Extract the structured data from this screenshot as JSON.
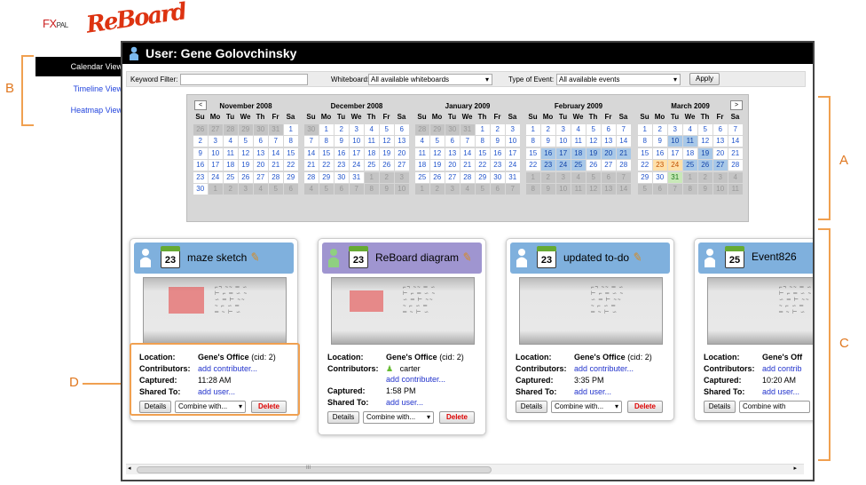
{
  "logos": {
    "fxpal": "FX",
    "fxpal_tail": "PAL",
    "reboard": "ReBoard"
  },
  "callouts": {
    "a": "A",
    "b": "B",
    "c": "C",
    "d": "D"
  },
  "sidebar": {
    "items": [
      {
        "label": "Calendar View",
        "active": true
      },
      {
        "label": "Timeline View",
        "active": false
      },
      {
        "label": "Heatmap View",
        "active": false
      }
    ]
  },
  "window": {
    "title": "User: Gene Golovchinsky"
  },
  "filters": {
    "keyword_label": "Keyword Filter:",
    "keyword_value": "",
    "whiteboard_label": "Whiteboard:",
    "whiteboard_value": "All available whiteboards",
    "event_type_label": "Type of Event:",
    "event_type_value": "All available events",
    "apply_label": "Apply"
  },
  "calendar": {
    "prev": "<",
    "next": ">",
    "weekdays": [
      "Su",
      "Mo",
      "Tu",
      "We",
      "Th",
      "Fr",
      "Sa"
    ],
    "months": [
      {
        "title": "November 2008",
        "days": [
          [
            "26",
            "o"
          ],
          [
            "27",
            "o"
          ],
          [
            "28",
            "o"
          ],
          [
            "29",
            "o"
          ],
          [
            "30",
            "o"
          ],
          [
            "31",
            "o"
          ],
          [
            "1",
            ""
          ],
          [
            "2",
            ""
          ],
          [
            "3",
            ""
          ],
          [
            "4",
            ""
          ],
          [
            "5",
            ""
          ],
          [
            "6",
            ""
          ],
          [
            "7",
            ""
          ],
          [
            "8",
            ""
          ],
          [
            "9",
            ""
          ],
          [
            "10",
            ""
          ],
          [
            "11",
            ""
          ],
          [
            "12",
            ""
          ],
          [
            "13",
            ""
          ],
          [
            "14",
            ""
          ],
          [
            "15",
            ""
          ],
          [
            "16",
            ""
          ],
          [
            "17",
            ""
          ],
          [
            "18",
            ""
          ],
          [
            "19",
            ""
          ],
          [
            "20",
            ""
          ],
          [
            "21",
            ""
          ],
          [
            "22",
            ""
          ],
          [
            "23",
            ""
          ],
          [
            "24",
            ""
          ],
          [
            "25",
            ""
          ],
          [
            "26",
            ""
          ],
          [
            "27",
            ""
          ],
          [
            "28",
            ""
          ],
          [
            "29",
            ""
          ],
          [
            "30",
            ""
          ],
          [
            "1",
            "o"
          ],
          [
            "2",
            "o"
          ],
          [
            "3",
            "o"
          ],
          [
            "4",
            "o"
          ],
          [
            "5",
            "o"
          ],
          [
            "6",
            "o"
          ]
        ]
      },
      {
        "title": "December 2008",
        "days": [
          [
            "30",
            "o"
          ],
          [
            "1",
            ""
          ],
          [
            "2",
            ""
          ],
          [
            "3",
            ""
          ],
          [
            "4",
            ""
          ],
          [
            "5",
            ""
          ],
          [
            "6",
            ""
          ],
          [
            "7",
            ""
          ],
          [
            "8",
            ""
          ],
          [
            "9",
            ""
          ],
          [
            "10",
            ""
          ],
          [
            "11",
            ""
          ],
          [
            "12",
            ""
          ],
          [
            "13",
            ""
          ],
          [
            "14",
            ""
          ],
          [
            "15",
            ""
          ],
          [
            "16",
            ""
          ],
          [
            "17",
            ""
          ],
          [
            "18",
            ""
          ],
          [
            "19",
            ""
          ],
          [
            "20",
            ""
          ],
          [
            "21",
            ""
          ],
          [
            "22",
            ""
          ],
          [
            "23",
            ""
          ],
          [
            "24",
            ""
          ],
          [
            "25",
            ""
          ],
          [
            "26",
            ""
          ],
          [
            "27",
            ""
          ],
          [
            "28",
            ""
          ],
          [
            "29",
            ""
          ],
          [
            "30",
            ""
          ],
          [
            "31",
            ""
          ],
          [
            "1",
            "o"
          ],
          [
            "2",
            "o"
          ],
          [
            "3",
            "o"
          ],
          [
            "4",
            "o"
          ],
          [
            "5",
            "o"
          ],
          [
            "6",
            "o"
          ],
          [
            "7",
            "o"
          ],
          [
            "8",
            "o"
          ],
          [
            "9",
            "o"
          ],
          [
            "10",
            "o"
          ]
        ]
      },
      {
        "title": "January 2009",
        "days": [
          [
            "28",
            "o"
          ],
          [
            "29",
            "o"
          ],
          [
            "30",
            "o"
          ],
          [
            "31",
            "o"
          ],
          [
            "1",
            ""
          ],
          [
            "2",
            ""
          ],
          [
            "3",
            ""
          ],
          [
            "4",
            ""
          ],
          [
            "5",
            ""
          ],
          [
            "6",
            ""
          ],
          [
            "7",
            ""
          ],
          [
            "8",
            ""
          ],
          [
            "9",
            ""
          ],
          [
            "10",
            ""
          ],
          [
            "11",
            ""
          ],
          [
            "12",
            ""
          ],
          [
            "13",
            ""
          ],
          [
            "14",
            ""
          ],
          [
            "15",
            ""
          ],
          [
            "16",
            ""
          ],
          [
            "17",
            ""
          ],
          [
            "18",
            ""
          ],
          [
            "19",
            ""
          ],
          [
            "20",
            ""
          ],
          [
            "21",
            ""
          ],
          [
            "22",
            ""
          ],
          [
            "23",
            ""
          ],
          [
            "24",
            ""
          ],
          [
            "25",
            ""
          ],
          [
            "26",
            ""
          ],
          [
            "27",
            ""
          ],
          [
            "28",
            ""
          ],
          [
            "29",
            ""
          ],
          [
            "30",
            ""
          ],
          [
            "31",
            ""
          ],
          [
            "1",
            "o"
          ],
          [
            "2",
            "o"
          ],
          [
            "3",
            "o"
          ],
          [
            "4",
            "o"
          ],
          [
            "5",
            "o"
          ],
          [
            "6",
            "o"
          ],
          [
            "7",
            "o"
          ]
        ]
      },
      {
        "title": "February 2009",
        "days": [
          [
            "1",
            ""
          ],
          [
            "2",
            ""
          ],
          [
            "3",
            ""
          ],
          [
            "4",
            ""
          ],
          [
            "5",
            ""
          ],
          [
            "6",
            ""
          ],
          [
            "7",
            ""
          ],
          [
            "8",
            ""
          ],
          [
            "9",
            ""
          ],
          [
            "10",
            ""
          ],
          [
            "11",
            ""
          ],
          [
            "12",
            ""
          ],
          [
            "13",
            ""
          ],
          [
            "14",
            ""
          ],
          [
            "15",
            ""
          ],
          [
            "16",
            "h"
          ],
          [
            "17",
            "h"
          ],
          [
            "18",
            "h"
          ],
          [
            "19",
            "h"
          ],
          [
            "20",
            "h"
          ],
          [
            "21",
            "h"
          ],
          [
            "22",
            ""
          ],
          [
            "23",
            "h"
          ],
          [
            "24",
            "h"
          ],
          [
            "25",
            "h"
          ],
          [
            "26",
            ""
          ],
          [
            "27",
            ""
          ],
          [
            "28",
            ""
          ],
          [
            "1",
            "o"
          ],
          [
            "2",
            "o"
          ],
          [
            "3",
            "o"
          ],
          [
            "4",
            "o"
          ],
          [
            "5",
            "o"
          ],
          [
            "6",
            "o"
          ],
          [
            "7",
            "o"
          ],
          [
            "8",
            "o"
          ],
          [
            "9",
            "o"
          ],
          [
            "10",
            "o"
          ],
          [
            "11",
            "o"
          ],
          [
            "12",
            "o"
          ],
          [
            "13",
            "o"
          ],
          [
            "14",
            "o"
          ]
        ]
      },
      {
        "title": "March 2009",
        "days": [
          [
            "1",
            ""
          ],
          [
            "2",
            ""
          ],
          [
            "3",
            ""
          ],
          [
            "4",
            ""
          ],
          [
            "5",
            ""
          ],
          [
            "6",
            ""
          ],
          [
            "7",
            ""
          ],
          [
            "8",
            ""
          ],
          [
            "9",
            ""
          ],
          [
            "10",
            "h"
          ],
          [
            "11",
            "h"
          ],
          [
            "12",
            ""
          ],
          [
            "13",
            ""
          ],
          [
            "14",
            ""
          ],
          [
            "15",
            ""
          ],
          [
            "16",
            ""
          ],
          [
            "17",
            ""
          ],
          [
            "18",
            ""
          ],
          [
            "19",
            "h"
          ],
          [
            "20",
            ""
          ],
          [
            "21",
            ""
          ],
          [
            "22",
            ""
          ],
          [
            "23",
            "or"
          ],
          [
            "24",
            "or"
          ],
          [
            "25",
            "h"
          ],
          [
            "26",
            "h"
          ],
          [
            "27",
            "h"
          ],
          [
            "28",
            ""
          ],
          [
            "29",
            ""
          ],
          [
            "30",
            ""
          ],
          [
            "31",
            "gr"
          ],
          [
            "1",
            "o"
          ],
          [
            "2",
            "o"
          ],
          [
            "3",
            "o"
          ],
          [
            "4",
            "o"
          ],
          [
            "5",
            "o"
          ],
          [
            "6",
            "o"
          ],
          [
            "7",
            "o"
          ],
          [
            "8",
            "o"
          ],
          [
            "9",
            "o"
          ],
          [
            "10",
            "o"
          ],
          [
            "11",
            "o"
          ]
        ]
      }
    ]
  },
  "labels": {
    "location": "Location:",
    "contributors": "Contributors:",
    "captured": "Captured:",
    "shared_to": "Shared To:",
    "add_contributor": "add contributer...",
    "add_user": "add user...",
    "details": "Details",
    "combine": "Combine with...",
    "delete": "Delete"
  },
  "cards": [
    {
      "day": "23",
      "title": "maze sketch",
      "location": "Gene's Office",
      "cid": "(cid: 2)",
      "captured": "11:28 AM"
    },
    {
      "day": "23",
      "title": "ReBoard diagram",
      "location": "Gene's Office",
      "cid": "(cid: 2)",
      "contributor": "carter",
      "captured": "1:58 PM"
    },
    {
      "day": "23",
      "title": "updated to-do",
      "location": "Gene's Office",
      "cid": "(cid: 2)",
      "captured": "3:35 PM"
    },
    {
      "day": "25",
      "title": "Event826",
      "location": "Gene's Off",
      "captured": "10:20 AM",
      "add_contributor": "add contrib",
      "combine": "Combine with"
    }
  ],
  "scrollbar": {
    "grip": "III"
  },
  "colors": {
    "accent": "#e07820",
    "header_blue": "#7fb0dd",
    "header_purple": "#9f95d0",
    "link": "#2233cc"
  }
}
